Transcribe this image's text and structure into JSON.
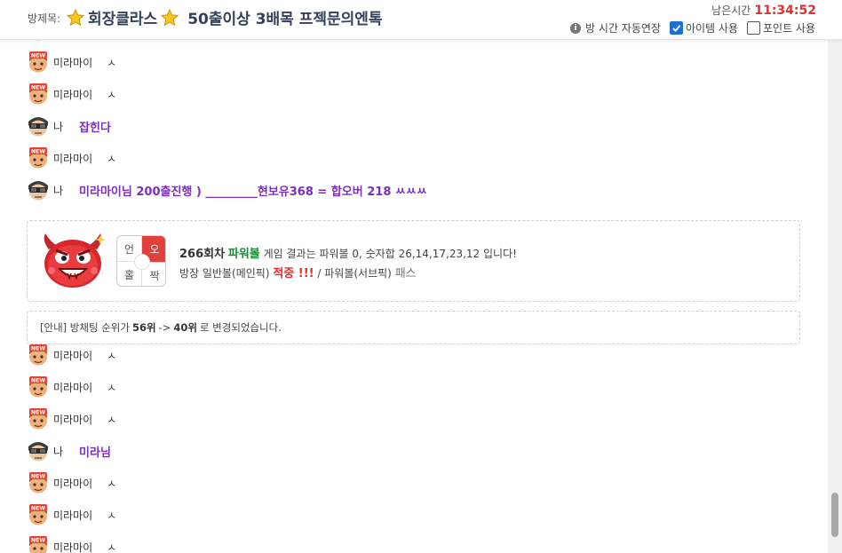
{
  "header": {
    "room_label": "방제목:",
    "title_highlight": "회장클라스",
    "title_rest": "50출이상 3배목 프젝문의엔톡",
    "remaining_label": "남은시간",
    "remaining_time": "11:34:52",
    "auto_extend_label": "방 시간 자동연장",
    "item_use_label": "아이템 사용",
    "item_use_checked": true,
    "point_use_label": "포인트 사용",
    "point_use_checked": false
  },
  "chat": {
    "rows": [
      {
        "type": "new",
        "nick": "미라마이",
        "msg": "ㅅ"
      },
      {
        "type": "new",
        "nick": "미라마이",
        "msg": "ㅅ"
      },
      {
        "type": "new",
        "nick": "미라마이",
        "msg": "ㅅ"
      },
      {
        "type": "me",
        "nick": "나",
        "msg": "잡힌다"
      },
      {
        "type": "new",
        "nick": "미라마이",
        "msg": "ㅅ"
      },
      {
        "type": "me",
        "nick": "나",
        "msg": "미라마이님 200출진행 ) _________현보유368 = 합오버 218 ㅆㅆㅆ"
      },
      {
        "type": "new",
        "nick": "미라마이",
        "msg": "ㅅ"
      },
      {
        "type": "new",
        "nick": "미라마이",
        "msg": "ㅅ"
      },
      {
        "type": "new",
        "nick": "미라마이",
        "msg": "ㅅ"
      },
      {
        "type": "me",
        "nick": "나",
        "msg": "미라님"
      },
      {
        "type": "new",
        "nick": "미라마이",
        "msg": "ㅅ"
      },
      {
        "type": "new",
        "nick": "미라마이",
        "msg": "ㅅ"
      },
      {
        "type": "new",
        "nick": "미라마이",
        "msg": "ㅅ"
      }
    ],
    "result": {
      "grid": {
        "tl": "언",
        "tr": "오",
        "bl": "홀",
        "br": "짝"
      },
      "round": "266회차",
      "game": "파워볼",
      "line1_rest": "게임 결과는 파워볼 0, 숫자합 26,14,17,23,12 입니다!",
      "line2_prefix": "방장 일반볼(메인픽)",
      "hit": "적중 !!!",
      "line2_mid": "/ 파워볼(서브픽)",
      "pass": "패스"
    },
    "notice": {
      "prefix": "[안내] 방채팅 순위가",
      "from": "56위",
      "arrow": "->",
      "to": "40위",
      "suffix": "로 변경되었습니다."
    }
  },
  "colors": {
    "title": "#34405a",
    "time": "#e0312f",
    "my_message": "#7b2fc2",
    "powerball_green": "#1a8a33",
    "hit_red": "#e0312f"
  }
}
